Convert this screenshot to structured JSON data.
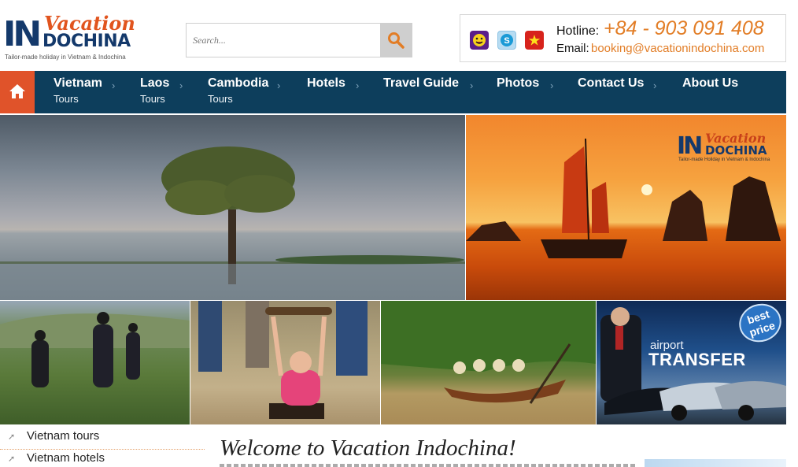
{
  "header": {
    "logo": {
      "big": "IN",
      "script": "Vacation",
      "word": "DOCHINA",
      "tagline": "Tailor-made holiday in Vietnam & Indochina"
    },
    "search": {
      "placeholder": "Search...",
      "icon": "search-icon"
    },
    "contact": {
      "icons": [
        "yahoo-messenger-icon",
        "skype-icon",
        "vietnam-flag-icon"
      ],
      "hotline_label": "Hotline:",
      "hotline_value": "+84 - 903 091 408",
      "email_label": "Email:",
      "email_value": "booking@vacationindochina.com"
    }
  },
  "nav": {
    "home_icon": "home-icon",
    "items": [
      {
        "title": "Vietnam",
        "subtitle": "Tours"
      },
      {
        "title": "Laos",
        "subtitle": "Tours"
      },
      {
        "title": "Cambodia",
        "subtitle": "Tours"
      },
      {
        "title": "Hotels",
        "subtitle": ""
      },
      {
        "title": "Travel Guide",
        "subtitle": ""
      },
      {
        "title": "Photos",
        "subtitle": ""
      },
      {
        "title": "Contact Us",
        "subtitle": ""
      },
      {
        "title": "About Us",
        "subtitle": ""
      }
    ],
    "chevron": "›"
  },
  "banner": {
    "halong_logo": {
      "big": "IN",
      "script": "Vacation",
      "word": "DOCHINA",
      "tagline": "Tailor-made Holiday in Vietnam & Indochina"
    },
    "airport": {
      "badge": "best price",
      "line1": "airport",
      "line2": "TRANSFER"
    }
  },
  "sidebar": {
    "items": [
      {
        "label": "Vietnam tours"
      },
      {
        "label": "Vietnam hotels"
      }
    ]
  },
  "main": {
    "welcome_title": "Welcome to Vacation Indochina!"
  },
  "colors": {
    "nav_bg": "#0d3e5c",
    "accent_orange": "#e27d26",
    "home_bg": "#e0532a",
    "logo_blue": "#14396b"
  }
}
